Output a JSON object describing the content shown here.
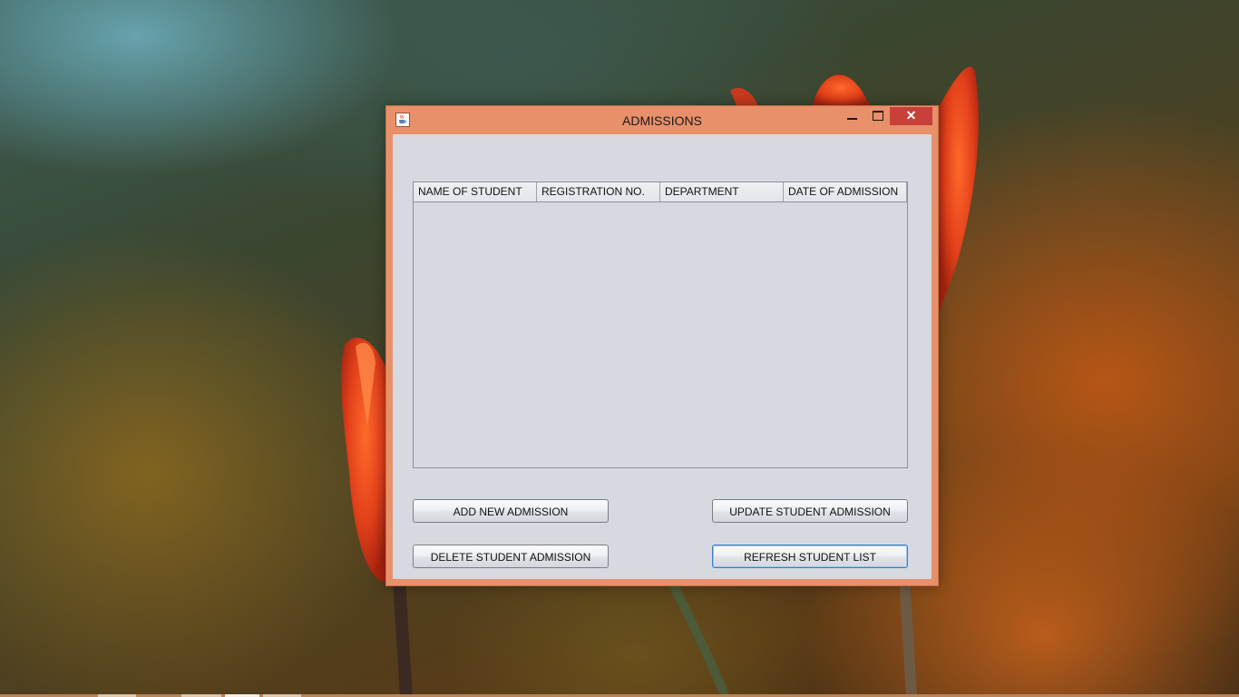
{
  "window": {
    "title": "ADMISSIONS",
    "close_symbol": "✕",
    "icons": {
      "app": "java-coffee-cup-icon",
      "minimize": "minimize-icon",
      "maximize": "maximize-icon",
      "close": "close-icon"
    }
  },
  "table": {
    "columns": [
      "NAME OF STUDENT",
      "REGISTRATION NO.",
      "DEPARTMENT",
      "DATE OF ADMISSION"
    ],
    "rows": []
  },
  "buttons": {
    "add": "ADD NEW ADMISSION",
    "update": "UPDATE STUDENT ADMISSION",
    "delete": "DELETE STUDENT ADMISSION",
    "refresh": "REFRESH STUDENT LIST"
  },
  "colors": {
    "titlebar": "#e8906a",
    "close_button": "#c7413a",
    "client_background": "#d6d9e0"
  }
}
